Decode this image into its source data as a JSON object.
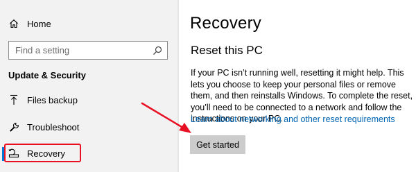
{
  "sidebar": {
    "home_label": "Home",
    "search_placeholder": "Find a setting",
    "section_title": "Update & Security",
    "items": [
      {
        "label": "Files backup",
        "icon": "upload-arrow-icon"
      },
      {
        "label": "Troubleshoot",
        "icon": "wrench-icon"
      },
      {
        "label": "Recovery",
        "icon": "recovery-drive-icon",
        "active": true
      }
    ]
  },
  "main": {
    "title": "Recovery",
    "subtitle": "Reset this PC",
    "description": "If your PC isn’t running well, resetting it might help. This lets you choose to keep your personal files or remove them, and then reinstalls Windows. To complete the reset, you’ll need to be connected to a network and follow the instructions on your PC.",
    "link": "Learn about networking and other reset requirements",
    "button": "Get started"
  },
  "colors": {
    "accent": "#0078d7",
    "annotation": "#e81123",
    "link": "#0063b1"
  }
}
